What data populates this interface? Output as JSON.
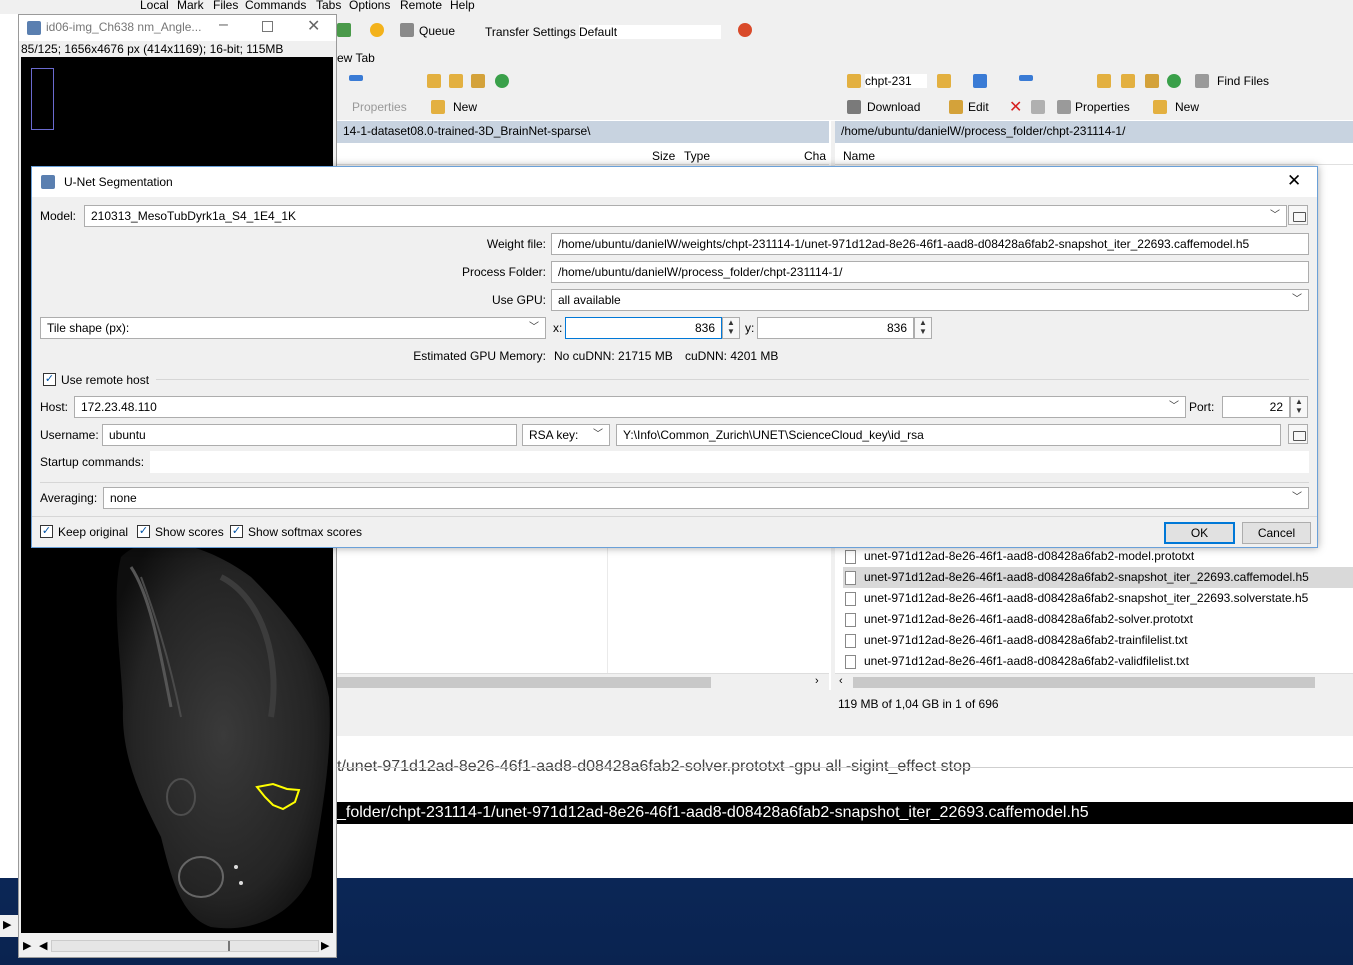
{
  "menu": [
    "Local",
    "Mark",
    "Files",
    "Commands",
    "Tabs",
    "Options",
    "Remote",
    "Help"
  ],
  "toolbar": {
    "queue": "Queue",
    "transfer_settings_label": "Transfer Settings",
    "transfer_settings_value": "Default",
    "new_tab": "ew Tab",
    "left_properties": "Properties",
    "left_new": "New",
    "right_path_combo": "chpt-231",
    "find_files": "Find Files",
    "download": "Download",
    "edit": "Edit",
    "right_properties": "Properties",
    "right_new": "New"
  },
  "left_panel": {
    "path": "14-1-dataset08.0-trained-3D_BrainNet-sparse\\",
    "col_size": "Size",
    "col_type": "Type",
    "col_changed": "Cha"
  },
  "right_panel": {
    "path": "/home/ubuntu/danielW/process_folder/chpt-231114-1/",
    "col_name": "Name",
    "files": [
      "unet-971d12ad-8e26-46f1-aad8-d08428a6fab2-model.prototxt",
      "unet-971d12ad-8e26-46f1-aad8-d08428a6fab2-snapshot_iter_22693.caffemodel.h5",
      "unet-971d12ad-8e26-46f1-aad8-d08428a6fab2-snapshot_iter_22693.solverstate.h5",
      "unet-971d12ad-8e26-46f1-aad8-d08428a6fab2-solver.prototxt",
      "unet-971d12ad-8e26-46f1-aad8-d08428a6fab2-trainfilelist.txt",
      "unet-971d12ad-8e26-46f1-aad8-d08428a6fab2-validfilelist.txt"
    ],
    "status": "119 MB of 1,04 GB in 1 of 696"
  },
  "console": {
    "line1": "t/unet-971d12ad-8e26-46f1-aad8-d08428a6fab2-solver.prototxt -gpu all -sigint_effect stop",
    "line2": "_folder/chpt-231114-1/unet-971d12ad-8e26-46f1-aad8-d08428a6fab2-snapshot_iter_22693.caffemodel.h5"
  },
  "image_window": {
    "title": "id06-img_Ch638 nm_Angle...",
    "info": "85/125; 1656x4676 px (414x1169); 16-bit; 115MB"
  },
  "dialog": {
    "title": "U-Net Segmentation",
    "model_label": "Model:",
    "model_value": "210313_MesoTubDyrk1a_S4_1E4_1K",
    "weight_label": "Weight file:",
    "weight_value": "/home/ubuntu/danielW/weights/chpt-231114-1/unet-971d12ad-8e26-46f1-aad8-d08428a6fab2-snapshot_iter_22693.caffemodel.h5",
    "process_label": "Process Folder:",
    "process_value": "/home/ubuntu/danielW/process_folder/chpt-231114-1/",
    "gpu_label": "Use GPU:",
    "gpu_value": "all available",
    "tile_value": "Tile shape (px):",
    "x_label": "x:",
    "x_value": "836",
    "y_label": "y:",
    "y_value": "836",
    "mem_label": "Estimated GPU Memory:",
    "mem_nocudnn": "No cuDNN: 21715 MB",
    "mem_cudnn": "cuDNN: 4201 MB",
    "remote_label": "Use remote host",
    "remote_checked": true,
    "host_label": "Host:",
    "host_value": "172.23.48.110",
    "port_label": "Port:",
    "port_value": "22",
    "username_label": "Username:",
    "username_value": "ubuntu",
    "rsa_label": "RSA key:",
    "rsa_path": "Y:\\Info\\Common_Zurich\\UNET\\ScienceCloud_key\\id_rsa",
    "startup_label": "Startup commands:",
    "startup_value": "",
    "averaging_label": "Averaging:",
    "averaging_value": "none",
    "keep_original": "Keep original",
    "show_scores": "Show scores",
    "show_softmax": "Show softmax scores",
    "ok": "OK",
    "cancel": "Cancel"
  },
  "colors": {
    "dialog_border": "#6aa0d8",
    "path_bar": "#c8d3e0",
    "accent": "#0078d7",
    "console_bg": "#000000",
    "segmentation_outline": "#ffff00"
  }
}
